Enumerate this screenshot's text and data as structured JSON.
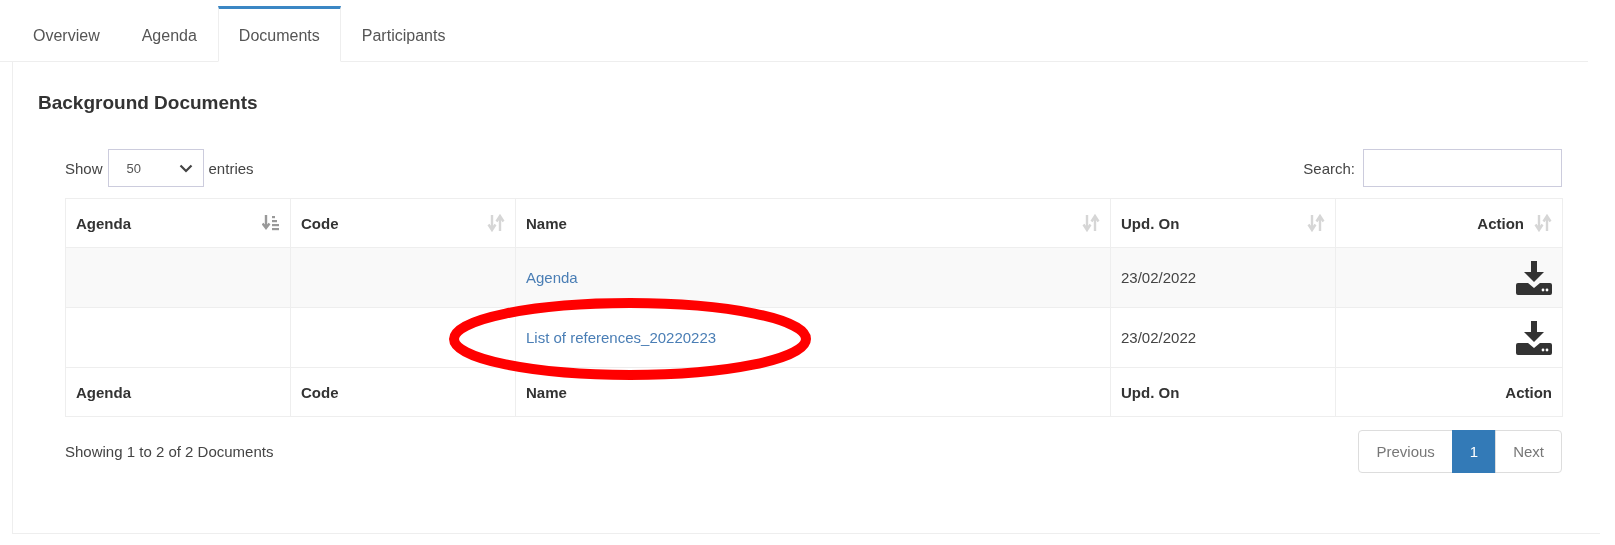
{
  "tabs": [
    {
      "label": "Overview",
      "selected": false
    },
    {
      "label": "Agenda",
      "selected": false
    },
    {
      "label": "Documents",
      "selected": true
    },
    {
      "label": "Participants",
      "selected": false
    }
  ],
  "heading": "Background Documents",
  "length_control": {
    "label_before": "Show",
    "value": "50",
    "label_after": "entries"
  },
  "search": {
    "label": "Search:"
  },
  "table": {
    "columns": [
      {
        "label": "Agenda",
        "sorted": true
      },
      {
        "label": "Code",
        "sorted": false
      },
      {
        "label": "Name",
        "sorted": false
      },
      {
        "label": "Upd. On",
        "sorted": false
      },
      {
        "label": "Action",
        "sorted": false
      }
    ],
    "rows": [
      {
        "name": "Agenda",
        "updated": "23/02/2022"
      },
      {
        "name": "List of references_20220223",
        "updated": "23/02/2022"
      }
    ],
    "footer": [
      "Agenda",
      "Code",
      "Name",
      "Upd. On",
      "Action"
    ]
  },
  "info": "Showing 1 to 2 of 2 Documents",
  "pagination": [
    {
      "label": "Previous",
      "selected": false,
      "disabled": true
    },
    {
      "label": "1",
      "selected": true,
      "disabled": false
    },
    {
      "label": "Next",
      "selected": false,
      "disabled": true
    }
  ]
}
